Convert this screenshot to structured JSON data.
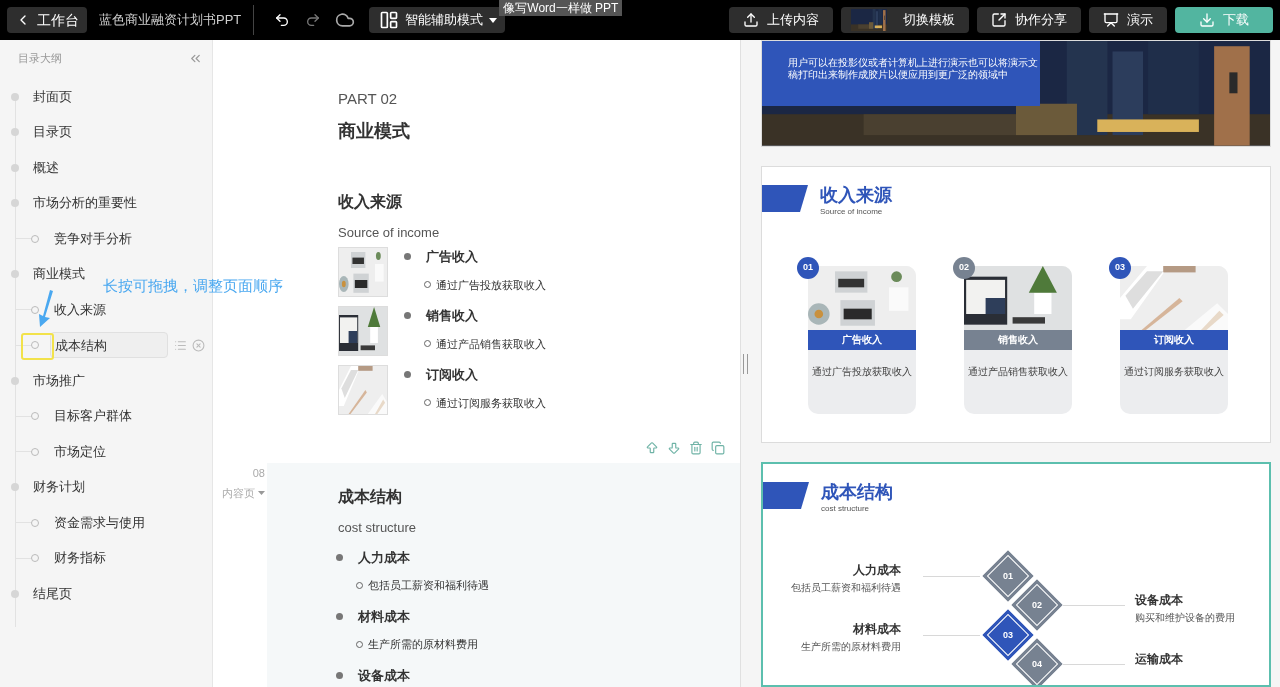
{
  "topbar": {
    "back": "工作台",
    "title": "蓝色商业融资计划书PPT",
    "mode": "智能辅助模式",
    "tooltip": "像写Word一样做 PPT",
    "actions": [
      {
        "kind": "upload",
        "label": "上传内容"
      },
      {
        "kind": "template",
        "label": "切换模板"
      },
      {
        "kind": "share",
        "label": "协作分享"
      },
      {
        "kind": "present",
        "label": "演示"
      },
      {
        "kind": "download",
        "label": "下载"
      }
    ]
  },
  "outline": {
    "heading": "目录大纲",
    "items": [
      {
        "label": "封面页",
        "selected": false
      },
      {
        "label": "目录页",
        "selected": false
      },
      {
        "label": "概述",
        "selected": false
      },
      {
        "label": "市场分析的重要性",
        "selected": false,
        "children": [
          {
            "label": "竞争对手分析",
            "selected": false
          }
        ]
      },
      {
        "label": "商业模式",
        "selected": false,
        "children": [
          {
            "label": "收入来源",
            "selected": false
          },
          {
            "label": "成本结构",
            "selected": true
          }
        ]
      },
      {
        "label": "市场推广",
        "selected": false,
        "children": [
          {
            "label": "目标客户群体",
            "selected": false
          },
          {
            "label": "市场定位",
            "selected": false
          }
        ]
      },
      {
        "label": "财务计划",
        "selected": false,
        "children": [
          {
            "label": "资金需求与使用",
            "selected": false
          },
          {
            "label": "财务指标",
            "selected": false
          }
        ]
      },
      {
        "label": "结尾页",
        "selected": false
      }
    ]
  },
  "hint": "长按可拖拽，调整页面顺序",
  "editor": {
    "pages": [
      {
        "selected": false,
        "part": "PART 02",
        "part_title": "商业模式",
        "title": "收入来源",
        "subtitle": "Source of income",
        "items": [
          {
            "title": "广告收入",
            "detail": "通过广告投放获取收入"
          },
          {
            "title": "销售收入",
            "detail": "通过产品销售获取收入"
          },
          {
            "title": "订阅收入",
            "detail": "通过订阅服务获取收入"
          }
        ]
      },
      {
        "selected": true,
        "number": "08",
        "type": "内容页",
        "title": "成本结构",
        "subtitle": "cost structure",
        "items": [
          {
            "title": "人力成本",
            "detail": "包括员工薪资和福利待遇"
          },
          {
            "title": "材料成本",
            "detail": "生产所需的原材料费用"
          },
          {
            "title": "设备成本"
          }
        ]
      }
    ]
  },
  "preview": {
    "slides": [
      {
        "kind": "cover",
        "selected": false,
        "text": "用户可以在投影仪或者计算机上进行演示也可以将演示文稿打印出来制作成胶片以便应用到更广泛的领域中"
      },
      {
        "kind": "cards",
        "selected": false,
        "title": "收入来源",
        "subtitle": "Source of income",
        "cards": [
          {
            "number": "01",
            "label": "广告收入",
            "detail": "通过广告投放获取收入",
            "color": "#2f55b9"
          },
          {
            "number": "02",
            "label": "销售收入",
            "detail": "通过产品销售获取收入",
            "color": "#778291"
          },
          {
            "number": "03",
            "label": "订阅收入",
            "detail": "通过订阅服务获取收入",
            "color": "#2f55b9"
          }
        ]
      },
      {
        "kind": "diamonds",
        "selected": true,
        "title": "成本结构",
        "subtitle": "cost structure",
        "items": [
          {
            "number": "01",
            "title": "人力成本",
            "detail": "包括员工薪资和福利待遇",
            "highlighted": false
          },
          {
            "number": "02",
            "title": "设备成本",
            "detail": "购买和维护设备的费用",
            "highlighted": false
          },
          {
            "number": "03",
            "title": "材料成本",
            "detail": "生产所需的原材料费用",
            "highlighted": true
          },
          {
            "number": "04",
            "title": "运输成本",
            "highlighted": false
          }
        ]
      }
    ]
  }
}
